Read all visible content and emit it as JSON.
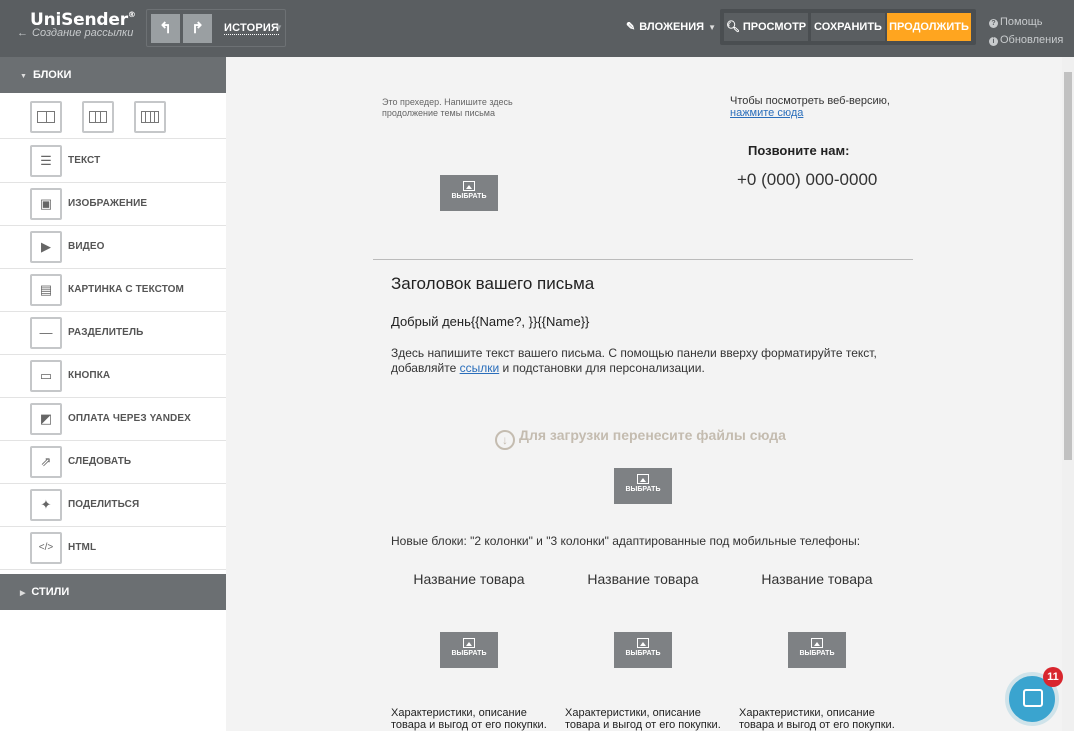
{
  "header": {
    "logo": "UniSender",
    "logo_mark": "®",
    "back_label": "Создание рассылки",
    "history_label": "ИСТОРИЯ",
    "attachments_label": "ВЛОЖЕНИЯ",
    "preview_label": "ПРОСМОТР",
    "save_label": "СОХРАНИТЬ",
    "continue_label": "ПРОДОЛЖИТЬ",
    "help_label": "Помощь",
    "updates_label": "Обновления",
    "accent_color": "#ffa51f"
  },
  "sidebar": {
    "blocks_heading": "БЛОКИ",
    "styles_heading": "СТИЛИ",
    "column_layouts": [
      "2-columns",
      "3-columns",
      "4-columns"
    ],
    "items": [
      {
        "label": "ТЕКСТ",
        "icon": "text-icon"
      },
      {
        "label": "ИЗОБРАЖЕНИЕ",
        "icon": "image-icon"
      },
      {
        "label": "ВИДЕО",
        "icon": "video-icon"
      },
      {
        "label": "КАРТИНКА С ТЕКСТОМ",
        "icon": "image-text-icon"
      },
      {
        "label": "РАЗДЕЛИТЕЛЬ",
        "icon": "divider-icon"
      },
      {
        "label": "КНОПКА",
        "icon": "button-icon"
      },
      {
        "label": "ОПЛАТА ЧЕРЕЗ YANDEX",
        "icon": "payment-icon"
      },
      {
        "label": "СЛЕДОВАТЬ",
        "icon": "follow-icon"
      },
      {
        "label": "ПОДЕЛИТЬСЯ",
        "icon": "twitter-icon"
      },
      {
        "label": "HTML",
        "icon": "code-icon"
      }
    ]
  },
  "email": {
    "preheader": "Это прехедер. Напишите здесь продолжение темы письма",
    "webversion_text": "Чтобы посмотреть веб-версию,",
    "webversion_link": "нажмите сюда",
    "call_us": "Позвоните нам:",
    "phone": "+0 (000) 000-0000",
    "pick_label": "ВЫБРАТЬ",
    "title": "Заголовок вашего письма",
    "greeting": "Добрый день{{Name?, }}{{Name}}",
    "body_before_link": "Здесь напишите текст вашего письма. С помощью панели вверху форматируйте текст, добавляйте ",
    "body_link": "ссылки",
    "body_after_link": " и подстановки для персонализации.",
    "dropzone": "Для загрузки перенесите файлы сюда",
    "new_blocks": "Новые блоки: \"2 колонки\" и \"3 колонки\" адаптированные под мобильные телефоны:",
    "products": [
      {
        "name": "Название товара",
        "desc": "Характеристики, описание товара и выгод от его покупки."
      },
      {
        "name": "Название товара",
        "desc": "Характеристики, описание товара и выгод от его покупки."
      },
      {
        "name": "Название товара",
        "desc": "Характеристики, описание товара и выгод от его покупки."
      }
    ]
  },
  "chat": {
    "badge_count": "11"
  }
}
